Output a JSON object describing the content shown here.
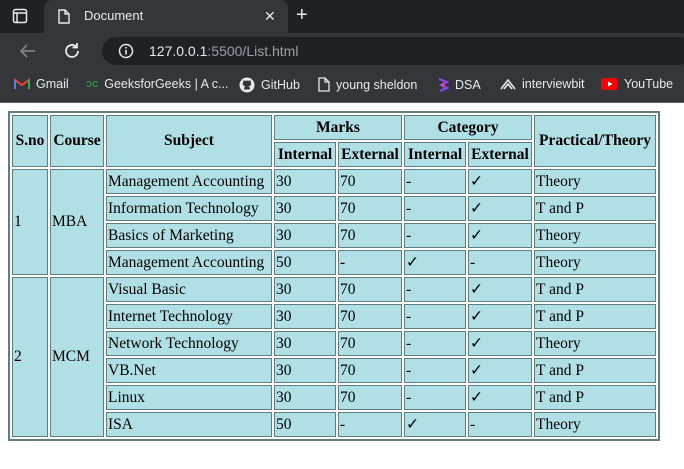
{
  "browser": {
    "tab_title": "Document",
    "url_host": "127.0.0.1",
    "url_rest": ":5500/List.html",
    "bookmarks": [
      {
        "label": "Gmail",
        "icon": "gmail-icon"
      },
      {
        "label": "GeeksforGeeks | A c...",
        "icon": "geeksforgeeks-icon"
      },
      {
        "label": "GitHub",
        "icon": "github-icon"
      },
      {
        "label": "young sheldon",
        "icon": "page-icon"
      },
      {
        "label": "DSA",
        "icon": "dsa-icon"
      },
      {
        "label": "interviewbit",
        "icon": "interviewbit-icon"
      },
      {
        "label": "YouTube",
        "icon": "youtube-icon"
      }
    ]
  },
  "table": {
    "headers": {
      "sno": "S.no",
      "course": "Course",
      "subject": "Subject",
      "marks": "Marks",
      "category": "Category",
      "practical_theory": "Practical/Theory",
      "internal": "Internal",
      "external": "External",
      "cat_internal": "Internal",
      "cat_external": "External"
    },
    "groups": [
      {
        "sno": "1",
        "course": "MBA",
        "rows": [
          {
            "subject": "Management Accounting",
            "internal": "30",
            "external": "70",
            "cat_internal": "-",
            "cat_external": "✓",
            "type": "Theory"
          },
          {
            "subject": "Information Technology",
            "internal": "30",
            "external": "70",
            "cat_internal": "-",
            "cat_external": "✓",
            "type": "T and P"
          },
          {
            "subject": "Basics of Marketing",
            "internal": "30",
            "external": "70",
            "cat_internal": "-",
            "cat_external": "✓",
            "type": "Theory"
          },
          {
            "subject": "Management Accounting",
            "internal": "50",
            "external": "-",
            "cat_internal": "✓",
            "cat_external": "-",
            "type": "Theory"
          }
        ]
      },
      {
        "sno": "2",
        "course": "MCM",
        "rows": [
          {
            "subject": "Visual Basic",
            "internal": "30",
            "external": "70",
            "cat_internal": "-",
            "cat_external": "✓",
            "type": "T and P"
          },
          {
            "subject": "Internet Technology",
            "internal": "30",
            "external": "70",
            "cat_internal": "-",
            "cat_external": "✓",
            "type": "T and P"
          },
          {
            "subject": "Network Technology",
            "internal": "30",
            "external": "70",
            "cat_internal": "-",
            "cat_external": "✓",
            "type": "Theory"
          },
          {
            "subject": "VB.Net",
            "internal": "30",
            "external": "70",
            "cat_internal": "-",
            "cat_external": "✓",
            "type": "T and P"
          },
          {
            "subject": "Linux",
            "internal": "30",
            "external": "70",
            "cat_internal": "-",
            "cat_external": "✓",
            "type": "T and P"
          },
          {
            "subject": "ISA",
            "internal": "50",
            "external": "-",
            "cat_internal": "✓",
            "cat_external": "-",
            "type": "Theory"
          }
        ]
      }
    ]
  },
  "colors": {
    "cell_background": "#b0e0e6",
    "cell_border": "#5f7f7f",
    "chrome_dark": "#202124",
    "chrome_toolbar": "#35363a"
  }
}
